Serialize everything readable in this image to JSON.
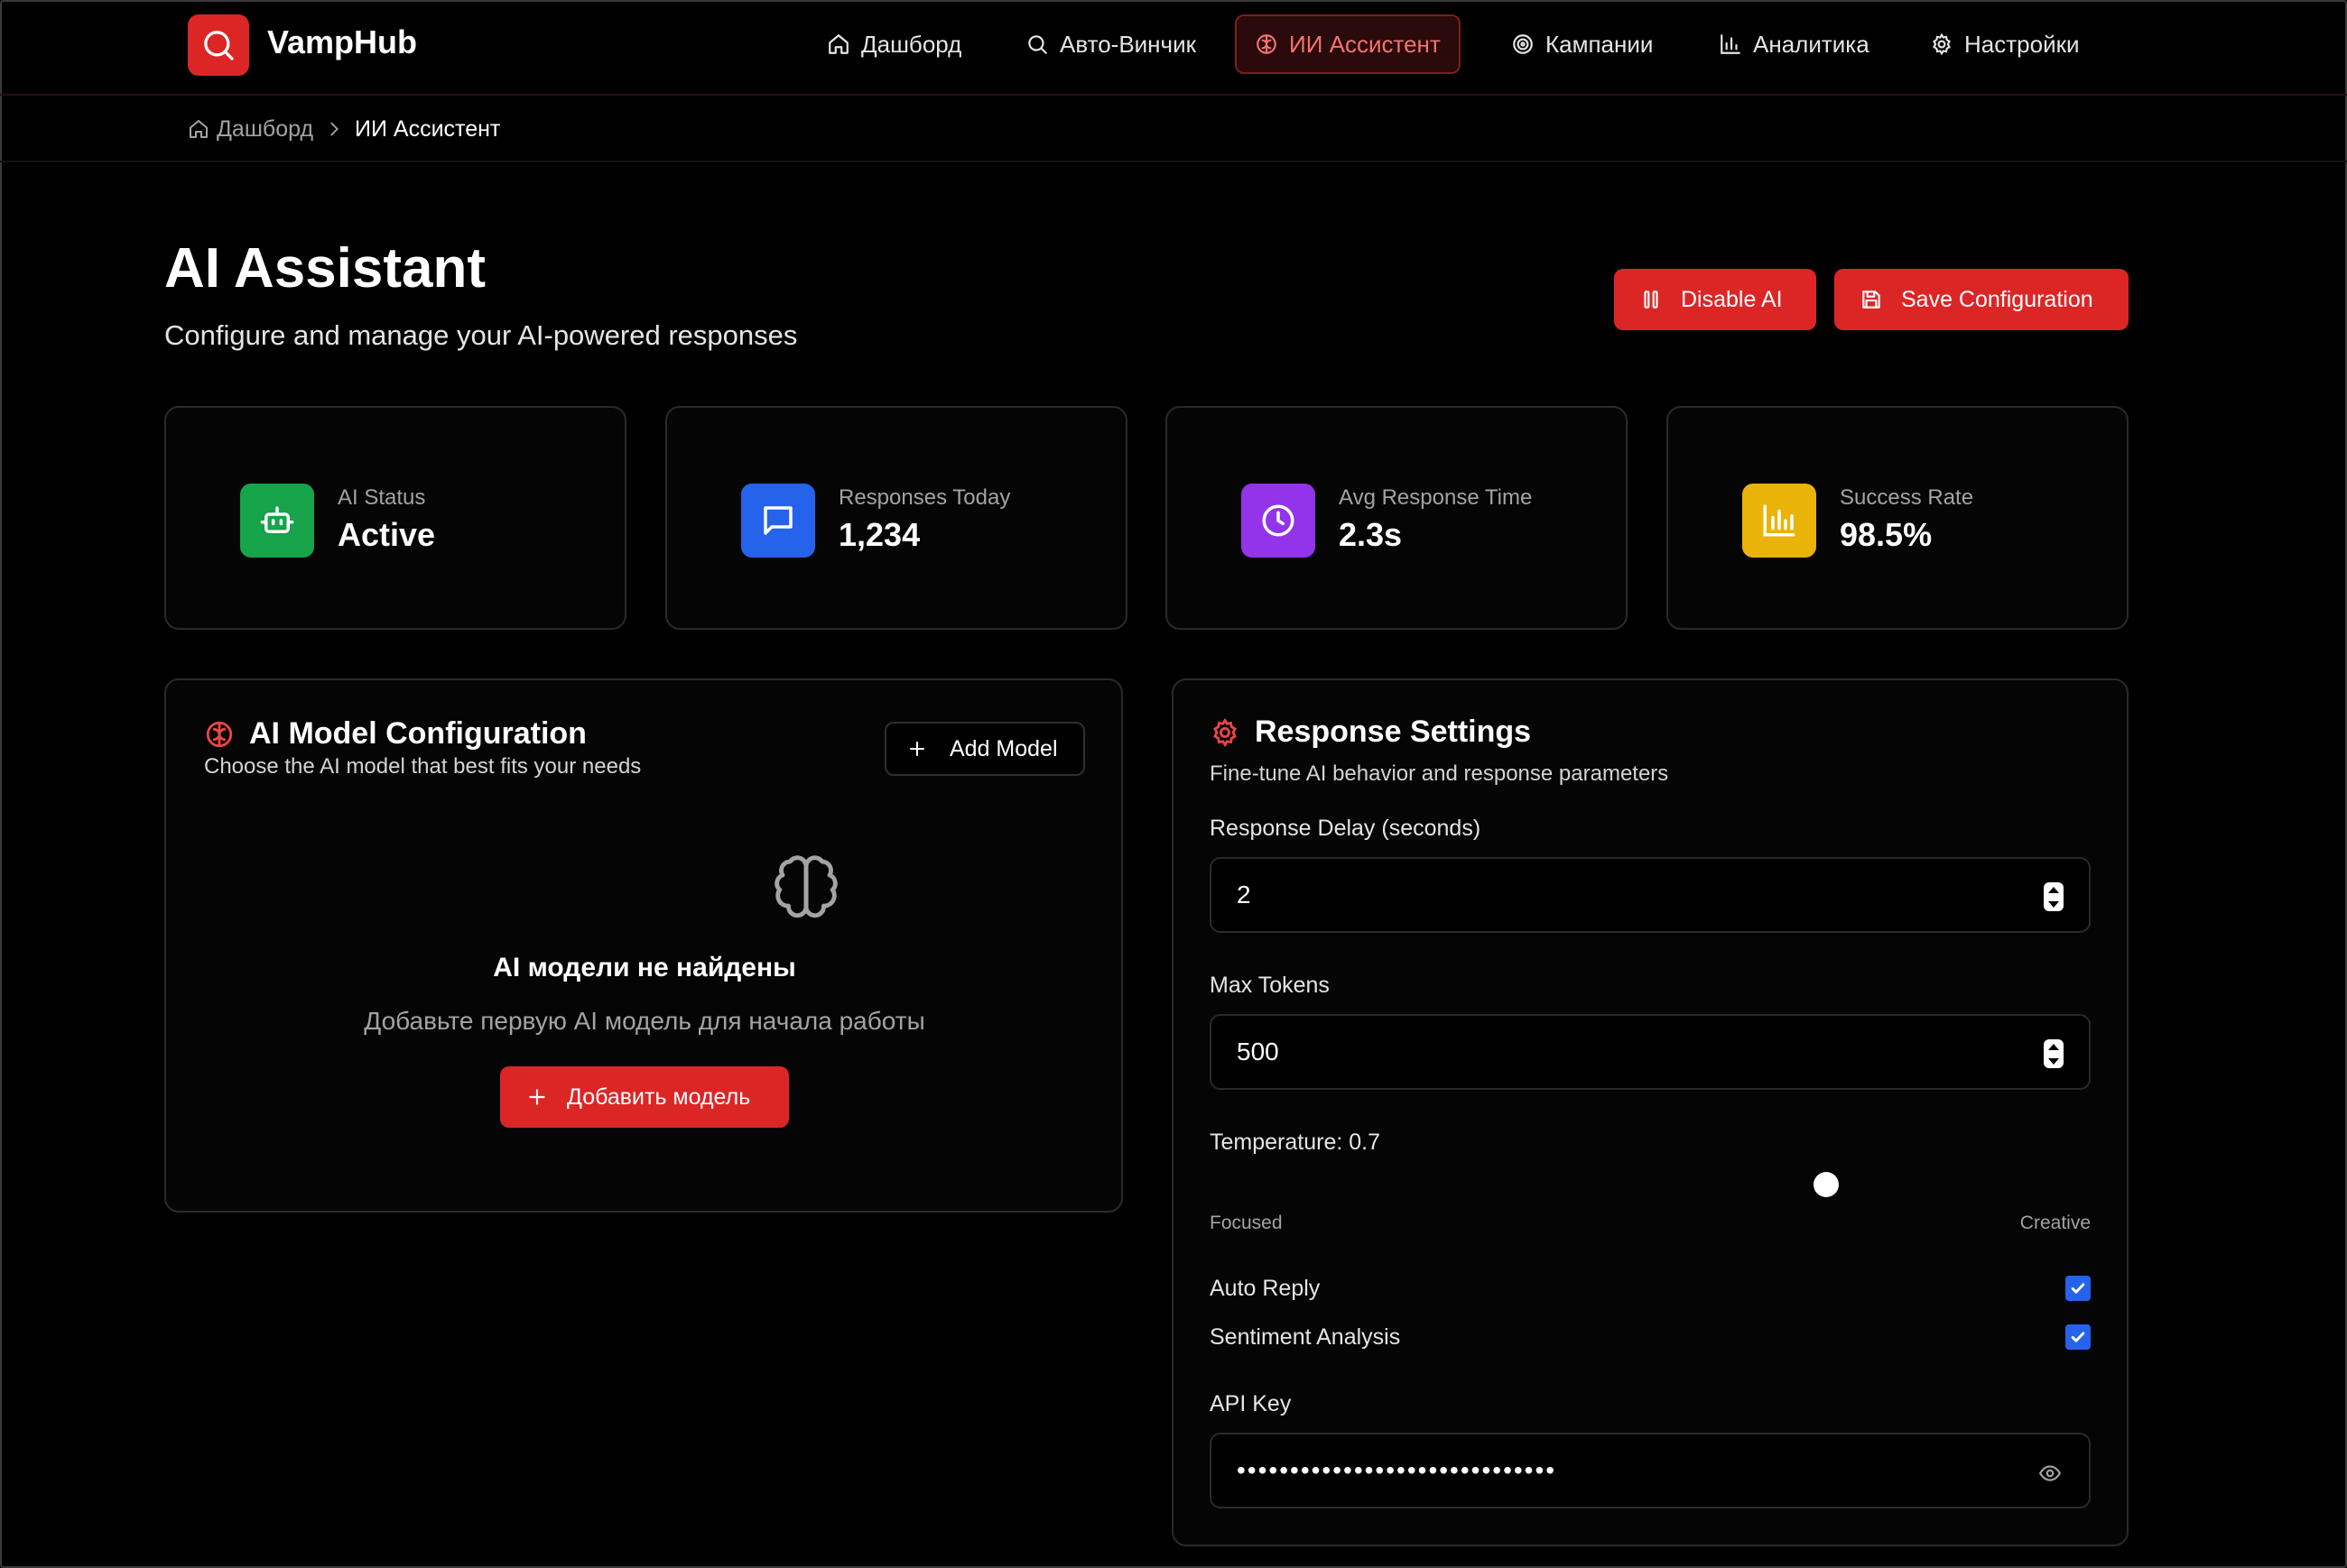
{
  "app": {
    "name": "VampHub"
  },
  "nav": {
    "items": [
      {
        "label": "Дашборд",
        "icon": "home-icon"
      },
      {
        "label": "Авто-Винчик",
        "icon": "search-icon"
      },
      {
        "label": "ИИ Ассистент",
        "icon": "brain-icon",
        "active": true
      },
      {
        "label": "Кампании",
        "icon": "target-icon"
      },
      {
        "label": "Аналитика",
        "icon": "bar-chart-icon"
      },
      {
        "label": "Настройки",
        "icon": "gear-icon"
      }
    ]
  },
  "breadcrumb": {
    "home": "Дашборд",
    "current": "ИИ Ассистент"
  },
  "header": {
    "title": "AI Assistant",
    "subtitle": "Configure and manage your AI-powered responses",
    "disable_label": "Disable AI",
    "save_label": "Save Configuration"
  },
  "stats": [
    {
      "label": "AI Status",
      "value": "Active",
      "color": "#16a34a",
      "icon": "bot-icon"
    },
    {
      "label": "Responses Today",
      "value": "1,234",
      "color": "#2563eb",
      "icon": "message-icon"
    },
    {
      "label": "Avg Response Time",
      "value": "2.3s",
      "color": "#9333ea",
      "icon": "clock-icon"
    },
    {
      "label": "Success Rate",
      "value": "98.5%",
      "color": "#eab308",
      "icon": "bar-chart-icon"
    }
  ],
  "model_panel": {
    "title": "AI Model Configuration",
    "subtitle": "Choose the AI model that best fits your needs",
    "add_label": "Add Model",
    "empty_title": "AI модели не найдены",
    "empty_text": "Добавьте первую AI модель для начала работы",
    "empty_button": "Добавить модель"
  },
  "settings_panel": {
    "title": "Response Settings",
    "subtitle": "Fine-tune AI behavior and response parameters",
    "delay_label": "Response Delay (seconds)",
    "delay_value": "2",
    "tokens_label": "Max Tokens",
    "tokens_value": "500",
    "temperature_label": "Temperature: 0.7",
    "temperature_value": 0.7,
    "focused_label": "Focused",
    "creative_label": "Creative",
    "auto_reply_label": "Auto Reply",
    "auto_reply_checked": true,
    "sentiment_label": "Sentiment Analysis",
    "sentiment_checked": true,
    "api_key_label": "API Key",
    "api_key_value": "••••••••••••••••••••••••••••••"
  },
  "colors": {
    "accent": "#dc2626",
    "checkbox": "#2563eb"
  }
}
